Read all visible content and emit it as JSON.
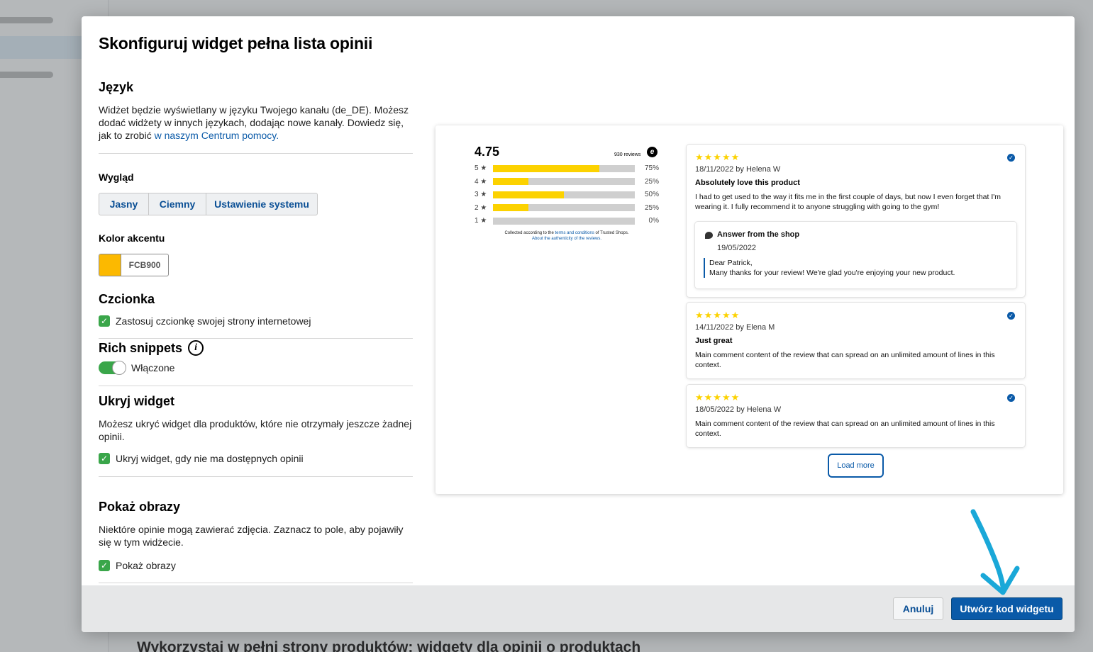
{
  "background": {
    "heading": "Wykorzystaj w pełni strony produktów: widgety dla opinii o produktach"
  },
  "modal": {
    "title": "Skonfiguruj widget pełna lista opinii"
  },
  "language": {
    "title": "Język",
    "text": "Widżet będzie wyświetlany w języku Twojego kanału (de_DE). Możesz dodać widżety w innych językach, dodając nowe kanały. Dowiedz się, jak to zrobić ",
    "link": "w naszym Centrum pomocy."
  },
  "appearance": {
    "label": "Wygląd",
    "options": [
      "Jasny",
      "Ciemny",
      "Ustawienie systemu"
    ]
  },
  "accent": {
    "label": "Kolor akcentu",
    "hex": "FCB900",
    "color": "#FCB900"
  },
  "font": {
    "title": "Czcionka",
    "checkbox": "Zastosuj czcionkę swojej strony internetowej",
    "checked": true
  },
  "rich_snippets": {
    "title": "Rich snippets",
    "toggle_label": "Włączone",
    "enabled": true
  },
  "hide_widget": {
    "title": "Ukryj widget",
    "text": "Możesz ukryć widget dla produktów, które nie otrzymały jeszcze żadnej opinii.",
    "checkbox": "Ukryj widget, gdy nie ma dostępnych opinii",
    "checked": true
  },
  "show_images": {
    "title": "Pokaż obrazy",
    "text": "Niektóre opinie mogą zawierać zdjęcia. Zaznacz to pole, aby pojawiły się w tym widżecie.",
    "checkbox": "Pokaż obrazy",
    "checked": true
  },
  "footer": {
    "cancel": "Anuluj",
    "create": "Utwórz kod widgetu"
  },
  "preview": {
    "rating": "4.75",
    "reviews_count": "930 reviews",
    "distribution": [
      {
        "label": "5 ★",
        "percent": 75,
        "text": "75%"
      },
      {
        "label": "4 ★",
        "percent": 25,
        "text": "25%"
      },
      {
        "label": "3 ★",
        "percent": 50,
        "text": "50%"
      },
      {
        "label": "2 ★",
        "percent": 25,
        "text": "25%"
      },
      {
        "label": "1 ★",
        "percent": 0,
        "text": "0%"
      }
    ],
    "collected_prefix": "Collected according to the ",
    "collected_link": "terms and conditions",
    "collected_suffix": " of Trusted Shops.",
    "authenticity_link": "About the authenticity of the reviews.",
    "reviews": [
      {
        "stars": "★★★★★",
        "date": "18/11/2022 by Helena W",
        "title": "Absolutely love this product",
        "body": "I had to get used to the way it fits me in the first couple of days, but now I even forget that I'm wearing it. I fully recommend it to anyone struggling with going to the gym!",
        "answer": {
          "title": "Answer from the shop",
          "date": "19/05/2022",
          "line1": "Dear Patrick,",
          "line2": "Many thanks for your review! We're glad you're enjoying your new product."
        }
      },
      {
        "stars": "★★★★★",
        "date": "14/11/2022 by Elena M",
        "title": "Just great",
        "body": "Main comment content of the review that can spread on an unlimited amount of lines in this context."
      },
      {
        "stars": "★★★★★",
        "date": "18/05/2022 by Helena W",
        "body": "Main comment content of the review that can spread on an unlimited amount of lines in this context."
      }
    ],
    "load_more": "Load more"
  }
}
